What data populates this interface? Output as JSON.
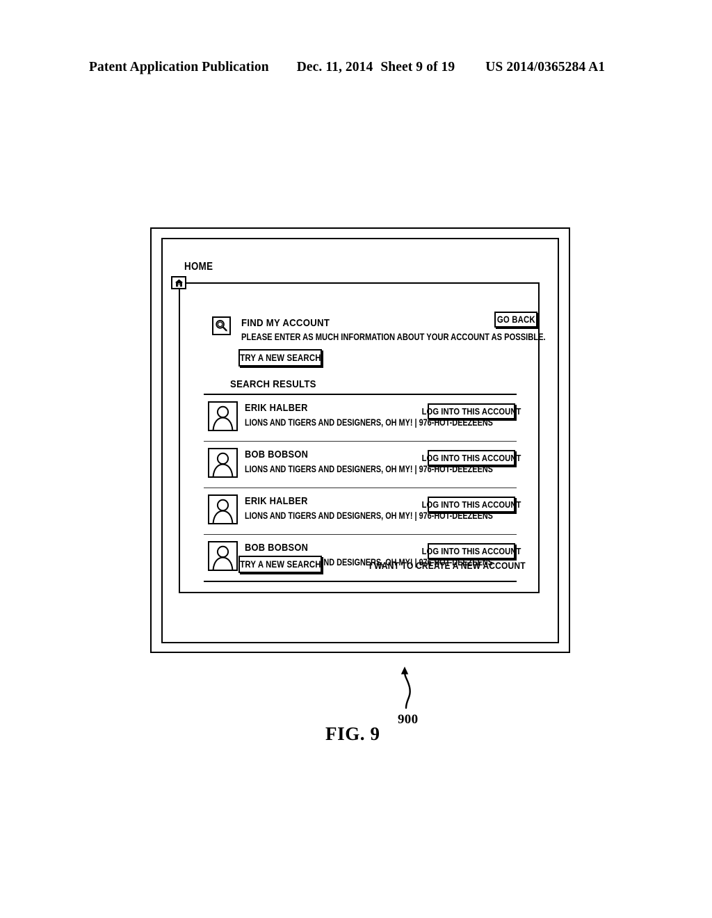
{
  "page_header": {
    "publication": "Patent Application Publication",
    "date": "Dec. 11, 2014",
    "sheet": "Sheet 9 of 19",
    "publication_number": "US 2014/0365284 A1"
  },
  "figure": {
    "caption": "FIG. 9",
    "reference_numeral": "900"
  },
  "window": {
    "home_label": "HOME",
    "home_icon": "home-icon"
  },
  "panel": {
    "search_icon": "magnifier-icon",
    "title": "FIND MY ACCOUNT",
    "subtitle": "PLEASE ENTER AS MUCH INFORMATION ABOUT YOUR ACCOUNT AS POSSIBLE.",
    "go_back_label": "GO BACK",
    "try_new_search_top_label": "TRY A NEW SEARCH",
    "results_heading": "SEARCH RESULTS",
    "try_new_search_bottom_label": "TRY A NEW SEARCH",
    "create_account_link": "I WANT TO CREATE A NEW ACCOUNT"
  },
  "results": [
    {
      "avatar": "person-avatar-icon",
      "name": "ERIK HALBER",
      "meta": "LIONS AND TIGERS AND DESIGNERS, OH MY! | 976-HOT-DEEZEENS",
      "action_label": "LOG INTO THIS ACCOUNT"
    },
    {
      "avatar": "person-avatar-icon",
      "name": "BOB BOBSON",
      "meta": "LIONS AND TIGERS AND DESIGNERS, OH MY! | 976-HOT-DEEZEENS",
      "action_label": "LOG INTO THIS ACCOUNT"
    },
    {
      "avatar": "person-avatar-icon",
      "name": "ERIK HALBER",
      "meta": "LIONS AND TIGERS AND DESIGNERS, OH MY! | 976-HOT-DEEZEENS",
      "action_label": "LOG INTO THIS ACCOUNT"
    },
    {
      "avatar": "person-avatar-icon",
      "name": "BOB BOBSON",
      "meta": "LIONS AND TIGERS AND DESIGNERS, OH MY! | 976-HOT-DEEZEENS",
      "action_label": "LOG INTO THIS ACCOUNT"
    }
  ],
  "colors": {
    "ink": "#000000",
    "paper": "#ffffff"
  }
}
